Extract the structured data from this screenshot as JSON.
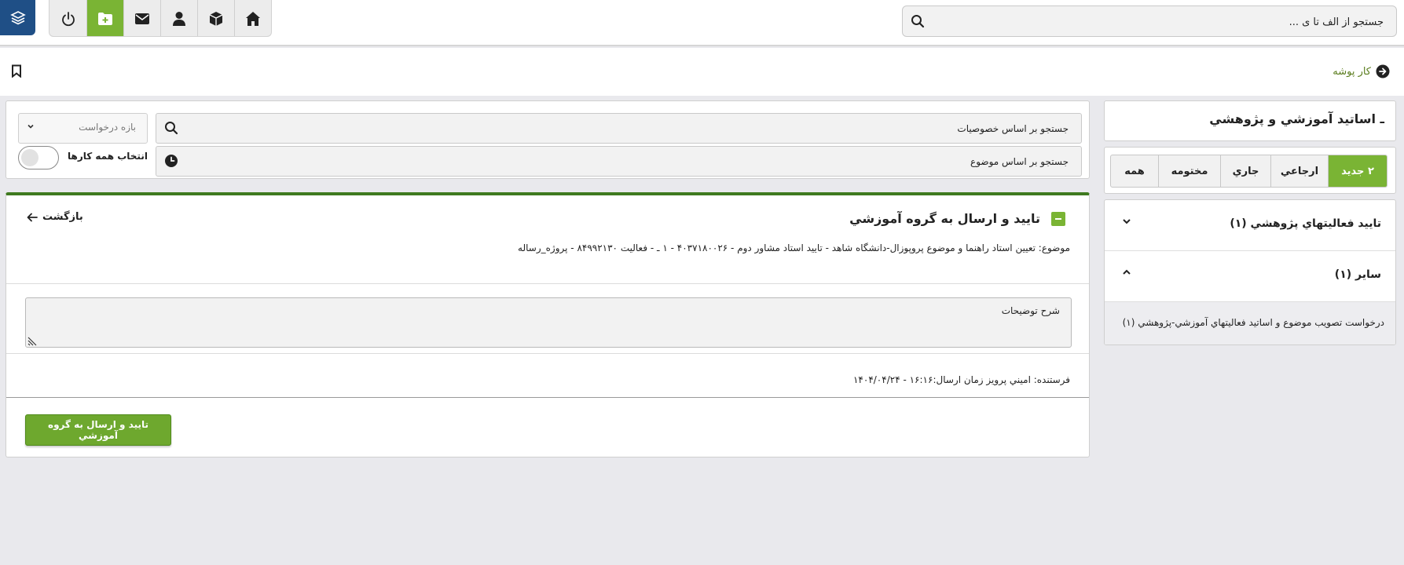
{
  "top_search": {
    "placeholder": "جستجو از الف تا ی ..."
  },
  "toolbar": {
    "icons": [
      "power-icon",
      "folder-plus-icon",
      "mail-icon",
      "user-icon",
      "box-icon",
      "home-icon"
    ]
  },
  "breadcrumb": {
    "label": "کار پوشه"
  },
  "sidebar": {
    "title": "ـ اساتيد آموزشي و پژوهشي",
    "status_tabs": [
      {
        "label": "۲ جديد",
        "active": true
      },
      {
        "label": "ارجاعي",
        "active": false
      },
      {
        "label": "جاري",
        "active": false
      },
      {
        "label": "مختومه",
        "active": false
      },
      {
        "label": "همه",
        "active": false
      }
    ],
    "categories": [
      {
        "label": "تاييد فعاليتهاي پژوهشي (۱)",
        "expanded": false
      },
      {
        "label": "ساير (۱)",
        "expanded": true
      }
    ],
    "sub_item": "درخواست تصويب موضوع و اساتيد فعاليتهاي آموزشي-پژوهشي (۱)"
  },
  "filters": {
    "search_properties": "جستجو بر اساس خصوصيات",
    "search_subject": "جستجو بر اساس موضوع",
    "range_select": "بازه درخواست",
    "select_all": "انتخاب همه کارها"
  },
  "card": {
    "title": "تاييد و ارسال به گروه آموزشي",
    "back": "بازگشت",
    "subject": "موضوع: تعيين استاد راهنما و موضوع پروپوزال-دانشگاه شاهد - تاييد استاد مشاور دوم - ۴۰۳۷۱۸۰۰۲۶ - ۱      ـ - فعاليت ۸۴۹۹۲۱۳۰ - پروژه_رساله",
    "description_placeholder": "شرح توضيحات",
    "sender": "فرستنده: اميني پرويز   زمان ارسال:۱۶:۱۶ - ۱۴۰۴/۰۴/۲۴",
    "submit": "تاييد و ارسال به گروه آموزشي"
  },
  "colors": {
    "accent_green": "#7ab434",
    "dark_green": "#3f7a1f",
    "logo_blue": "#1f4f86",
    "link_green": "#5b7d1e"
  }
}
